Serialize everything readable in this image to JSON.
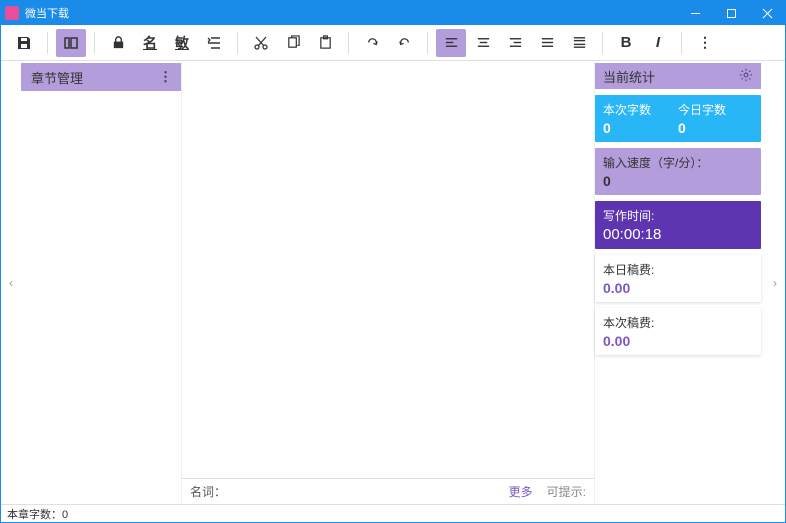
{
  "window": {
    "title": "微当下载"
  },
  "toolbar": {
    "save": "💾",
    "layout": "▦",
    "lock": "🔒",
    "name": "名",
    "min": "敏",
    "indent": "⇄",
    "cut": "✂",
    "copy": "⧉",
    "paste": "📋",
    "redo": "↻",
    "undo": "↺",
    "alignL": "≡",
    "alignC": "≡",
    "alignR": "≡",
    "alignJ": "≡",
    "alignD": "≡",
    "bold": "B",
    "italic": "I",
    "more": "⋮"
  },
  "sidebar": {
    "title": "章节管理",
    "menu": "⋮"
  },
  "bottom": {
    "label": "名词：",
    "more": "更多",
    "hint": "可提示:"
  },
  "stats": {
    "header": "当前统计",
    "thisCountLabel": "本次字数",
    "thisCountVal": "0",
    "todayCountLabel": "今日字数",
    "todayCountVal": "0",
    "speedLabel": "输入速度（字/分）：",
    "speedVal": "0",
    "timeLabel": "写作时间:",
    "timeVal": "00:00:18",
    "todayFeeLabel": "本日稿费:",
    "todayFeeVal": "0.00",
    "thisFeeLabel": "本次稿费:",
    "thisFeeVal": "0.00"
  },
  "status": {
    "chapterCount": "本章字数：0"
  }
}
